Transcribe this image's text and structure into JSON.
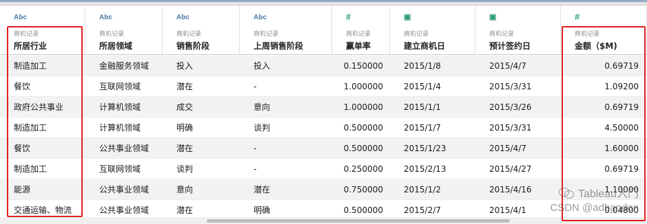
{
  "columns": [
    {
      "type_icon": "Abc",
      "type_kind": "text",
      "source": "商机记录",
      "name": "所居行业"
    },
    {
      "type_icon": "Abc",
      "type_kind": "text",
      "source": "商机记录",
      "name": "所居领域"
    },
    {
      "type_icon": "Abc",
      "type_kind": "text",
      "source": "商机记录",
      "name": "销售阶段"
    },
    {
      "type_icon": "Abc",
      "type_kind": "text",
      "source": "商机记录",
      "name": "上周销售阶段"
    },
    {
      "type_icon": "#",
      "type_kind": "number",
      "source": "商机记录",
      "name": "赢单率"
    },
    {
      "type_icon": "▣",
      "type_kind": "date",
      "source": "商机记录",
      "name": "建立商机日"
    },
    {
      "type_icon": "▣",
      "type_kind": "date",
      "source": "商机记录",
      "name": "预计签约日"
    },
    {
      "type_icon": "#",
      "type_kind": "number",
      "source": "商机记录",
      "name": "金额（$M)"
    }
  ],
  "rows": [
    [
      "制造加工",
      "金融服务领域",
      "投入",
      "投入",
      "0.150000",
      "2015/1/8",
      "2015/4/7",
      "0.69719"
    ],
    [
      "餐饮",
      "互联网领域",
      "潜在",
      "-",
      "1.000000",
      "2015/1/4",
      "2015/3/31",
      "1.09200"
    ],
    [
      "政府公共事业",
      "计算机领域",
      "成交",
      "意向",
      "1.000000",
      "2015/1/1",
      "2015/3/26",
      "0.69719"
    ],
    [
      "制造加工",
      "计算机领域",
      "明确",
      "谈判",
      "0.500000",
      "2015/1/7",
      "2015/3/31",
      "4.50000"
    ],
    [
      "餐饮",
      "公共事业领域",
      "潜在",
      "-",
      "0.500000",
      "2015/1/23",
      "2015/4/7",
      "1.60000"
    ],
    [
      "制造加工",
      "互联网领域",
      "谈判",
      "-",
      "0.250000",
      "2015/2/13",
      "2015/4/27",
      "0.69719"
    ],
    [
      "能源",
      "公共事业领域",
      "意向",
      "潜在",
      "0.750000",
      "2015/1/2",
      "2015/4/16",
      "1.10000"
    ],
    [
      "交通运输、物流",
      "公共事业领域",
      "潜在",
      "明确",
      "0.500000",
      "2015/2/7",
      "2015/4/1",
      "0.04800"
    ]
  ],
  "watermark": {
    "line1": "Tableau入门",
    "line2": "CSDN @adbandon"
  },
  "colors": {
    "highlight_box": "#e02020",
    "text_type_icon": "#4e79a7",
    "num_date_icon": "#2e9c78"
  }
}
